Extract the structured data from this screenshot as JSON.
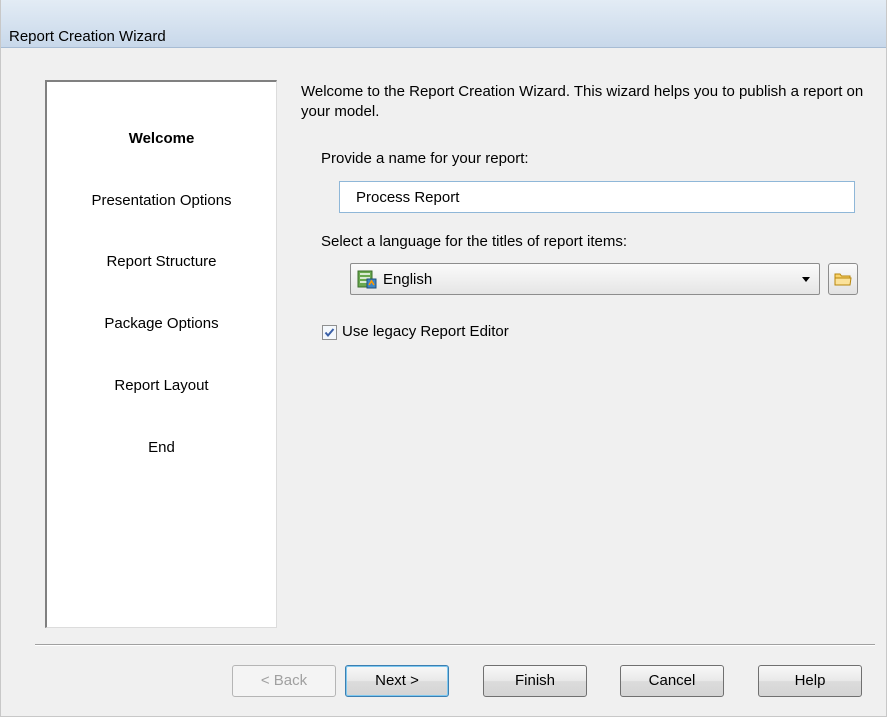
{
  "window": {
    "title": "Report Creation Wizard"
  },
  "steps": [
    {
      "label": "Welcome",
      "active": true
    },
    {
      "label": "Presentation Options",
      "active": false
    },
    {
      "label": "Report Structure",
      "active": false
    },
    {
      "label": "Package Options",
      "active": false
    },
    {
      "label": "Report Layout",
      "active": false
    },
    {
      "label": "End",
      "active": false
    }
  ],
  "main": {
    "welcome_text": "Welcome to the Report Creation Wizard. This wizard helps you to publish a report on your model.",
    "name_label": "Provide a name for your report:",
    "name_value": "Process Report",
    "language_label": "Select a language for the titles of report items:",
    "language_value": "English",
    "language_icon": "language-file-icon",
    "folder_icon": "folder-icon",
    "legacy_checkbox_label": "Use legacy Report Editor",
    "legacy_checked": true
  },
  "buttons": {
    "back": "< Back",
    "next": "Next >",
    "finish": "Finish",
    "cancel": "Cancel",
    "help": "Help"
  }
}
